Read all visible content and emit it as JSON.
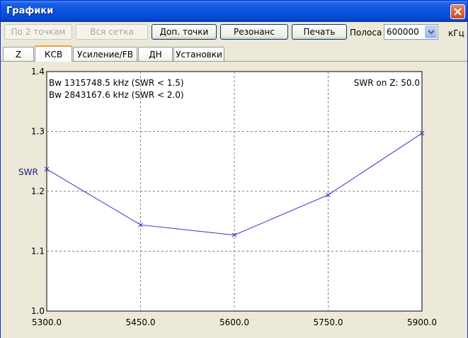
{
  "window": {
    "title": "Графики"
  },
  "toolbar": {
    "btn_two_points": "По 2 точкам",
    "btn_full_grid": "Вся сетка",
    "btn_extra_points": "Доп. точки",
    "btn_resonance": "Резонанс",
    "btn_print": "Печать",
    "band_label": "Полоса",
    "band_value": "600000",
    "unit_label": "кГц"
  },
  "tabs": [
    {
      "label": "Z"
    },
    {
      "label": "КСВ"
    },
    {
      "label": "Усиление/FB"
    },
    {
      "label": "ДН"
    },
    {
      "label": "Установки"
    }
  ],
  "active_tab": 1,
  "colors": {
    "series": "#3333cc",
    "grid": "#808080",
    "title_bar": "#0a53e0"
  },
  "chart_data": {
    "type": "line",
    "annotations": {
      "bw15": "Bw 1315748.5 kHz (SWR < 1.5)",
      "bw20": "Bw 2843167.6 kHz (SWR < 2.0)",
      "swr_on_z": "SWR on Z: 50.0"
    },
    "ylabel": "SWR",
    "xlabel": "",
    "x_ticks": [
      "5300.0",
      "5450.0",
      "5600.0",
      "5750.0",
      "5900.0"
    ],
    "y_ticks": [
      "1.0",
      "1.1",
      "1.2",
      "1.3",
      "1.4"
    ],
    "xlim": [
      5300,
      5900
    ],
    "ylim": [
      1.0,
      1.4
    ],
    "grid": true,
    "series": [
      {
        "x": [
          5300,
          5450,
          5600,
          5750,
          5900
        ],
        "y": [
          1.237,
          1.144,
          1.127,
          1.194,
          1.297
        ]
      }
    ]
  }
}
